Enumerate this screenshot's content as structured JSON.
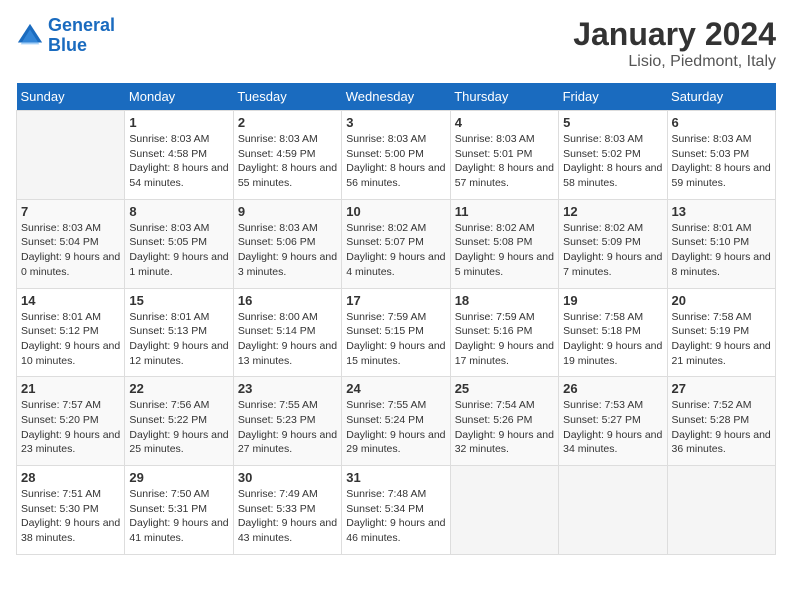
{
  "header": {
    "logo_line1": "General",
    "logo_line2": "Blue",
    "title": "January 2024",
    "subtitle": "Lisio, Piedmont, Italy"
  },
  "weekdays": [
    "Sunday",
    "Monday",
    "Tuesday",
    "Wednesday",
    "Thursday",
    "Friday",
    "Saturday"
  ],
  "weeks": [
    [
      {
        "day": "",
        "sunrise": "",
        "sunset": "",
        "daylight": "",
        "empty": true
      },
      {
        "day": "1",
        "sunrise": "Sunrise: 8:03 AM",
        "sunset": "Sunset: 4:58 PM",
        "daylight": "Daylight: 8 hours and 54 minutes."
      },
      {
        "day": "2",
        "sunrise": "Sunrise: 8:03 AM",
        "sunset": "Sunset: 4:59 PM",
        "daylight": "Daylight: 8 hours and 55 minutes."
      },
      {
        "day": "3",
        "sunrise": "Sunrise: 8:03 AM",
        "sunset": "Sunset: 5:00 PM",
        "daylight": "Daylight: 8 hours and 56 minutes."
      },
      {
        "day": "4",
        "sunrise": "Sunrise: 8:03 AM",
        "sunset": "Sunset: 5:01 PM",
        "daylight": "Daylight: 8 hours and 57 minutes."
      },
      {
        "day": "5",
        "sunrise": "Sunrise: 8:03 AM",
        "sunset": "Sunset: 5:02 PM",
        "daylight": "Daylight: 8 hours and 58 minutes."
      },
      {
        "day": "6",
        "sunrise": "Sunrise: 8:03 AM",
        "sunset": "Sunset: 5:03 PM",
        "daylight": "Daylight: 8 hours and 59 minutes."
      }
    ],
    [
      {
        "day": "7",
        "sunrise": "Sunrise: 8:03 AM",
        "sunset": "Sunset: 5:04 PM",
        "daylight": "Daylight: 9 hours and 0 minutes."
      },
      {
        "day": "8",
        "sunrise": "Sunrise: 8:03 AM",
        "sunset": "Sunset: 5:05 PM",
        "daylight": "Daylight: 9 hours and 1 minute."
      },
      {
        "day": "9",
        "sunrise": "Sunrise: 8:03 AM",
        "sunset": "Sunset: 5:06 PM",
        "daylight": "Daylight: 9 hours and 3 minutes."
      },
      {
        "day": "10",
        "sunrise": "Sunrise: 8:02 AM",
        "sunset": "Sunset: 5:07 PM",
        "daylight": "Daylight: 9 hours and 4 minutes."
      },
      {
        "day": "11",
        "sunrise": "Sunrise: 8:02 AM",
        "sunset": "Sunset: 5:08 PM",
        "daylight": "Daylight: 9 hours and 5 minutes."
      },
      {
        "day": "12",
        "sunrise": "Sunrise: 8:02 AM",
        "sunset": "Sunset: 5:09 PM",
        "daylight": "Daylight: 9 hours and 7 minutes."
      },
      {
        "day": "13",
        "sunrise": "Sunrise: 8:01 AM",
        "sunset": "Sunset: 5:10 PM",
        "daylight": "Daylight: 9 hours and 8 minutes."
      }
    ],
    [
      {
        "day": "14",
        "sunrise": "Sunrise: 8:01 AM",
        "sunset": "Sunset: 5:12 PM",
        "daylight": "Daylight: 9 hours and 10 minutes."
      },
      {
        "day": "15",
        "sunrise": "Sunrise: 8:01 AM",
        "sunset": "Sunset: 5:13 PM",
        "daylight": "Daylight: 9 hours and 12 minutes."
      },
      {
        "day": "16",
        "sunrise": "Sunrise: 8:00 AM",
        "sunset": "Sunset: 5:14 PM",
        "daylight": "Daylight: 9 hours and 13 minutes."
      },
      {
        "day": "17",
        "sunrise": "Sunrise: 7:59 AM",
        "sunset": "Sunset: 5:15 PM",
        "daylight": "Daylight: 9 hours and 15 minutes."
      },
      {
        "day": "18",
        "sunrise": "Sunrise: 7:59 AM",
        "sunset": "Sunset: 5:16 PM",
        "daylight": "Daylight: 9 hours and 17 minutes."
      },
      {
        "day": "19",
        "sunrise": "Sunrise: 7:58 AM",
        "sunset": "Sunset: 5:18 PM",
        "daylight": "Daylight: 9 hours and 19 minutes."
      },
      {
        "day": "20",
        "sunrise": "Sunrise: 7:58 AM",
        "sunset": "Sunset: 5:19 PM",
        "daylight": "Daylight: 9 hours and 21 minutes."
      }
    ],
    [
      {
        "day": "21",
        "sunrise": "Sunrise: 7:57 AM",
        "sunset": "Sunset: 5:20 PM",
        "daylight": "Daylight: 9 hours and 23 minutes."
      },
      {
        "day": "22",
        "sunrise": "Sunrise: 7:56 AM",
        "sunset": "Sunset: 5:22 PM",
        "daylight": "Daylight: 9 hours and 25 minutes."
      },
      {
        "day": "23",
        "sunrise": "Sunrise: 7:55 AM",
        "sunset": "Sunset: 5:23 PM",
        "daylight": "Daylight: 9 hours and 27 minutes."
      },
      {
        "day": "24",
        "sunrise": "Sunrise: 7:55 AM",
        "sunset": "Sunset: 5:24 PM",
        "daylight": "Daylight: 9 hours and 29 minutes."
      },
      {
        "day": "25",
        "sunrise": "Sunrise: 7:54 AM",
        "sunset": "Sunset: 5:26 PM",
        "daylight": "Daylight: 9 hours and 32 minutes."
      },
      {
        "day": "26",
        "sunrise": "Sunrise: 7:53 AM",
        "sunset": "Sunset: 5:27 PM",
        "daylight": "Daylight: 9 hours and 34 minutes."
      },
      {
        "day": "27",
        "sunrise": "Sunrise: 7:52 AM",
        "sunset": "Sunset: 5:28 PM",
        "daylight": "Daylight: 9 hours and 36 minutes."
      }
    ],
    [
      {
        "day": "28",
        "sunrise": "Sunrise: 7:51 AM",
        "sunset": "Sunset: 5:30 PM",
        "daylight": "Daylight: 9 hours and 38 minutes."
      },
      {
        "day": "29",
        "sunrise": "Sunrise: 7:50 AM",
        "sunset": "Sunset: 5:31 PM",
        "daylight": "Daylight: 9 hours and 41 minutes."
      },
      {
        "day": "30",
        "sunrise": "Sunrise: 7:49 AM",
        "sunset": "Sunset: 5:33 PM",
        "daylight": "Daylight: 9 hours and 43 minutes."
      },
      {
        "day": "31",
        "sunrise": "Sunrise: 7:48 AM",
        "sunset": "Sunset: 5:34 PM",
        "daylight": "Daylight: 9 hours and 46 minutes."
      },
      {
        "day": "",
        "sunrise": "",
        "sunset": "",
        "daylight": "",
        "empty": true
      },
      {
        "day": "",
        "sunrise": "",
        "sunset": "",
        "daylight": "",
        "empty": true
      },
      {
        "day": "",
        "sunrise": "",
        "sunset": "",
        "daylight": "",
        "empty": true
      }
    ]
  ]
}
